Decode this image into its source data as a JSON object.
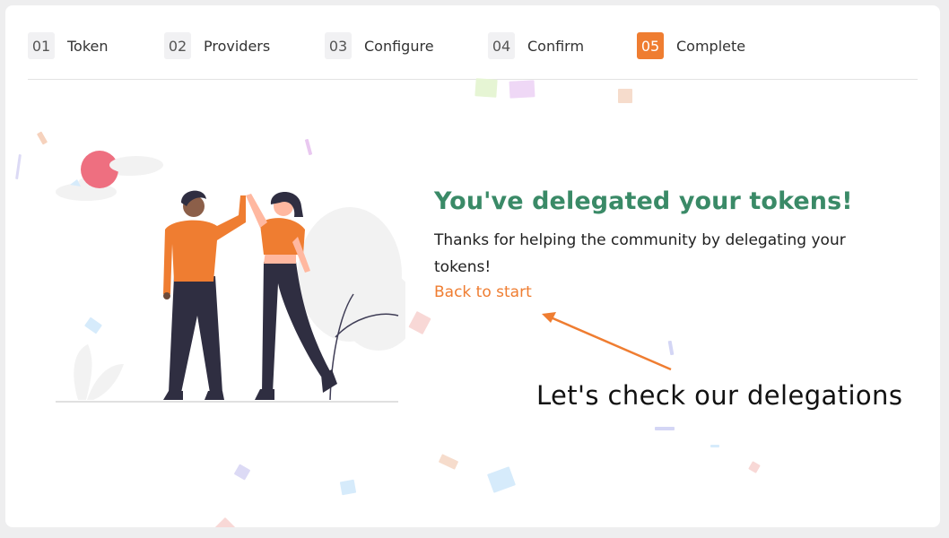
{
  "steps": [
    {
      "number": "01",
      "label": "Token"
    },
    {
      "number": "02",
      "label": "Providers"
    },
    {
      "number": "03",
      "label": "Configure"
    },
    {
      "number": "04",
      "label": "Confirm"
    },
    {
      "number": "05",
      "label": "Complete"
    }
  ],
  "active_step": "05",
  "success": {
    "title": "You've delegated your tokens!",
    "body": "Thanks for helping the community by delegating your tokens!",
    "back_link": "Back to start"
  },
  "annotation": {
    "text": "Let's check our delegations",
    "arrow_color": "#ef7d31"
  },
  "colors": {
    "accent": "#ef7d31",
    "success_title": "#3a8a67",
    "step_badge": "#f1f1f3"
  },
  "illustration": {
    "icon": "high-five-illustration"
  }
}
